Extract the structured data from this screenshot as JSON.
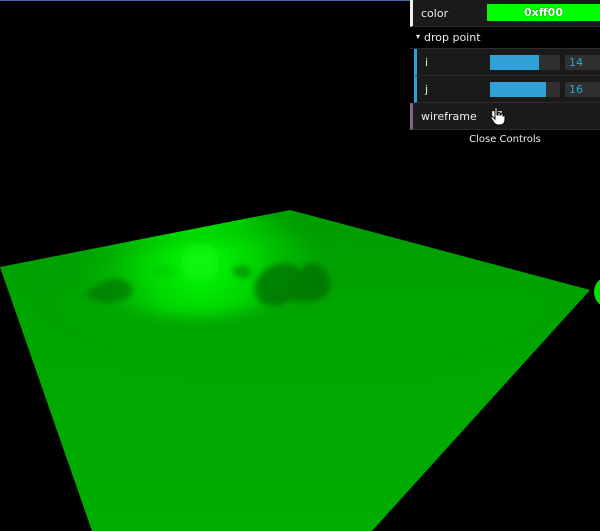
{
  "gui": {
    "color": {
      "label": "color",
      "value": "0xff00",
      "swatch": "#00ff00"
    },
    "folder": {
      "title": "drop point",
      "caret": "▾"
    },
    "i": {
      "label": "i",
      "value": "14",
      "fill_fraction": 0.7
    },
    "j": {
      "label": "j",
      "value": "16",
      "fill_fraction": 0.8
    },
    "wireframe": {
      "label": "wireframe",
      "checked": false
    },
    "close_label": "Close Controls"
  },
  "scene": {
    "plane_color": "#00a800",
    "highlight_color": "#00ff00",
    "background": "#000000"
  }
}
